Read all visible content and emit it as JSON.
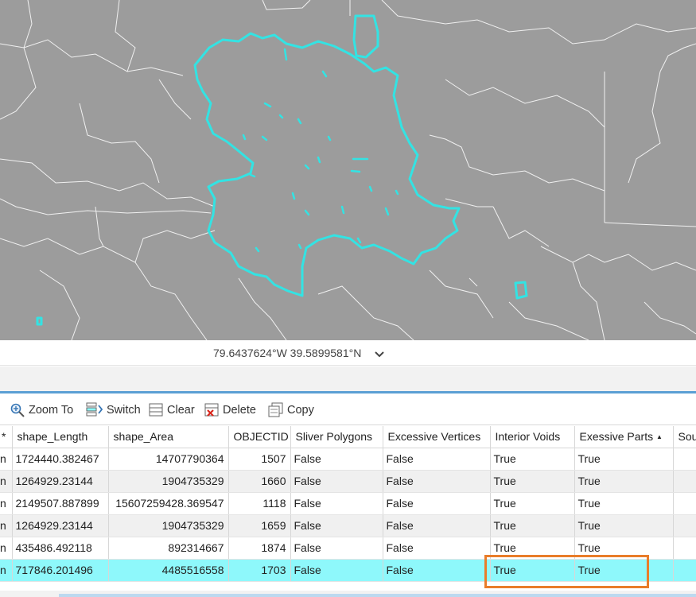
{
  "map": {
    "background_color": "#9c9c9c",
    "boundary_color": "#ffffff",
    "highlight_color": "#33e3e3"
  },
  "coordinates": {
    "text": "79.6437624°W 39.5899581°N",
    "dropdown_icon": "chevron-down-icon"
  },
  "toolbar": {
    "zoom_to": "Zoom To",
    "switch": "Switch",
    "clear": "Clear",
    "delete": "Delete",
    "copy": "Copy"
  },
  "table": {
    "columns": [
      "*",
      "shape_Length",
      "shape_Area",
      "OBJECTID",
      "Sliver Polygons",
      "Excessive Vertices",
      "Interior Voids",
      "Exessive Parts",
      "Sou"
    ],
    "sort_indicator": "▲",
    "rows": [
      {
        "shape": "n",
        "shape_Length": "1724440.382467",
        "shape_Area": "14707790364",
        "objectid": "1507",
        "sliver": "False",
        "vertices": "False",
        "voids": "True",
        "parts": "True",
        "sou": ""
      },
      {
        "shape": "n",
        "shape_Length": "1264929.23144",
        "shape_Area": "1904735329",
        "objectid": "1660",
        "sliver": "False",
        "vertices": "False",
        "voids": "True",
        "parts": "True",
        "sou": ""
      },
      {
        "shape": "n",
        "shape_Length": "2149507.887899",
        "shape_Area": "15607259428.369547",
        "objectid": "1118",
        "sliver": "False",
        "vertices": "False",
        "voids": "True",
        "parts": "True",
        "sou": ""
      },
      {
        "shape": "n",
        "shape_Length": "1264929.23144",
        "shape_Area": "1904735329",
        "objectid": "1659",
        "sliver": "False",
        "vertices": "False",
        "voids": "True",
        "parts": "True",
        "sou": ""
      },
      {
        "shape": "n",
        "shape_Length": "435486.492118",
        "shape_Area": "892314667",
        "objectid": "1874",
        "sliver": "False",
        "vertices": "False",
        "voids": "True",
        "parts": "True",
        "sou": ""
      },
      {
        "shape": "n",
        "shape_Length": "717846.201496",
        "shape_Area": "4485516558",
        "objectid": "1703",
        "sliver": "False",
        "vertices": "False",
        "voids": "True",
        "parts": "True",
        "sou": ""
      }
    ],
    "selected_row_index": 5,
    "selected_color": "#8ef8fb",
    "annotation_color": "#e97d2a"
  }
}
